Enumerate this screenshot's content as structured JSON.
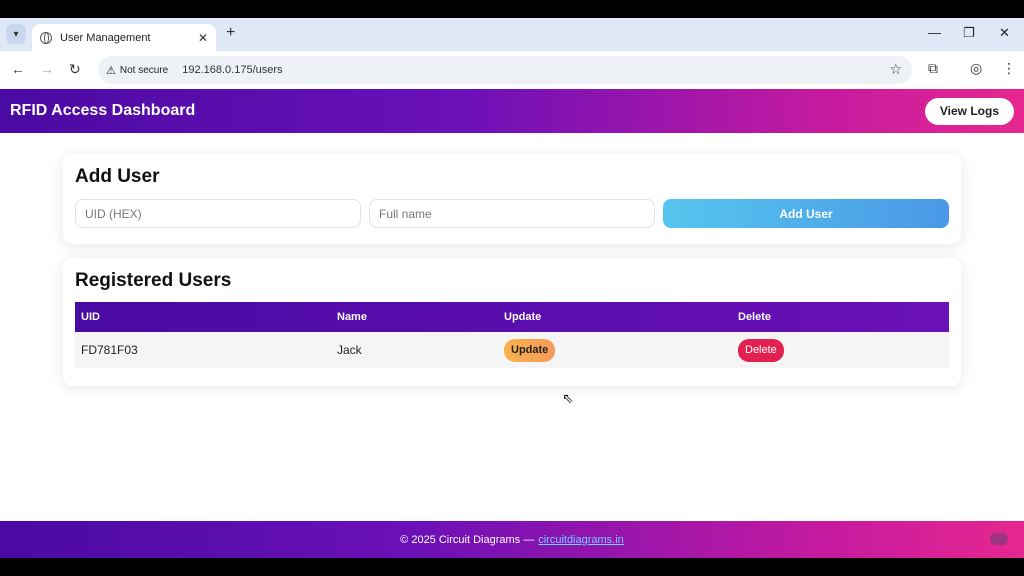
{
  "browser": {
    "tab_title": "User Management",
    "new_tab": "+",
    "security_label": "Not secure",
    "url": "192.168.0.175/users",
    "window_controls": {
      "minimize": "—",
      "restore": "❐",
      "close": "✕"
    }
  },
  "header": {
    "title": "RFID Access Dashboard",
    "view_logs_label": "View Logs"
  },
  "add_user": {
    "heading": "Add User",
    "uid_placeholder": "UID (HEX)",
    "name_placeholder": "Full name",
    "button_label": "Add User"
  },
  "registered_users": {
    "heading": "Registered Users",
    "columns": [
      "UID",
      "Name",
      "Update",
      "Delete"
    ],
    "rows": [
      {
        "uid": "FD781F03",
        "name": "Jack",
        "update_label": "Update",
        "delete_label": "Delete"
      }
    ]
  },
  "footer": {
    "text": "© 2025 Circuit Diagrams —",
    "link_text": "circuitdiagrams.in"
  },
  "colors": {
    "header_gradient_start": "#4a0aa3",
    "header_gradient_end": "#e6278f",
    "add_button": "#4a98e6",
    "update_button": "#f8b24a",
    "delete_button": "#e3204f"
  }
}
